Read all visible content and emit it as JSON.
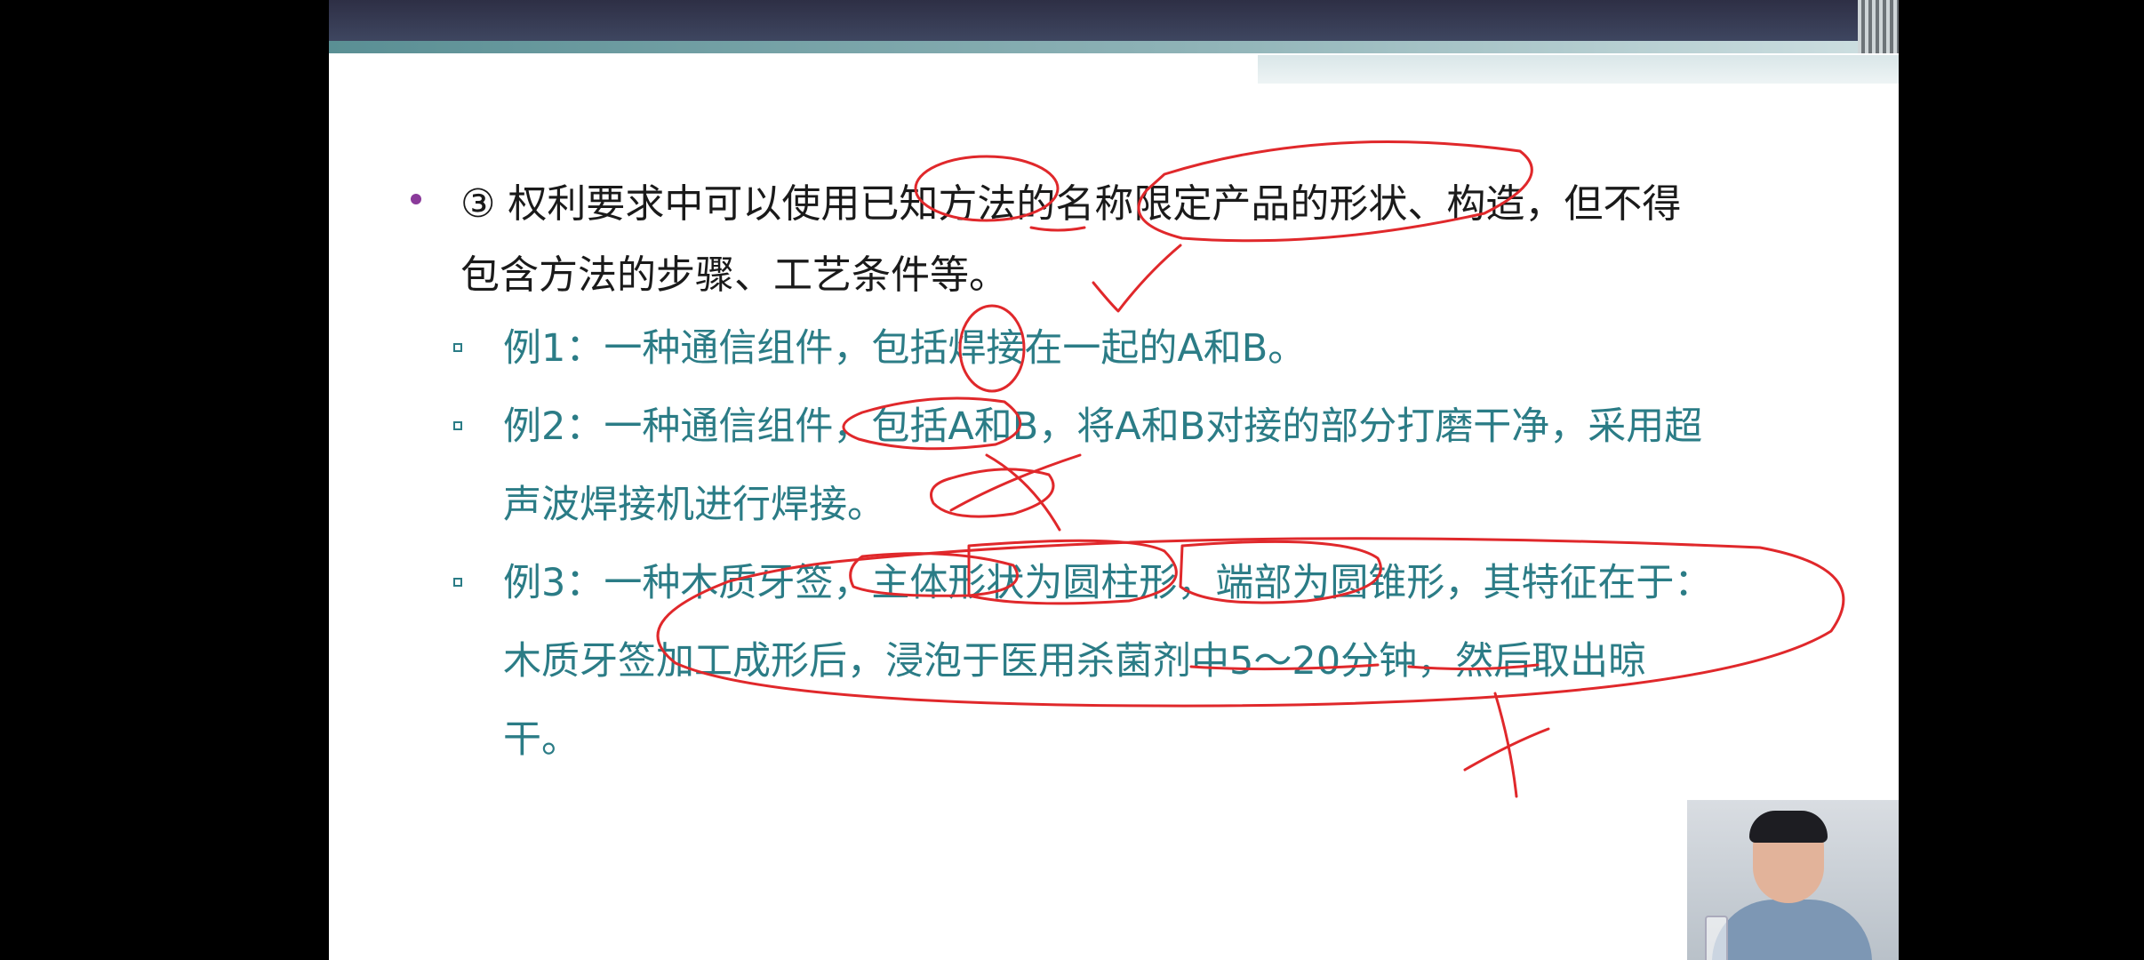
{
  "slide": {
    "main_bullet": "③ 权利要求中可以使用已知方法的名称限定产品的形状、构造，但不得包含方法的步骤、工艺条件等。",
    "examples": [
      {
        "text": "例1：一种通信组件，包括焊接在一起的A和B。"
      },
      {
        "text": "例2：一种通信组件，包括A和B，将A和B对接的部分打磨干净，采用超声波焊接机进行焊接。"
      },
      {
        "text": "例3：一种木质牙签，主体形状为圆柱形，端部为圆锥形，其特征在于：木质牙签加工成形后，浸泡于医用杀菌剂中5～20分钟，然后取出晾干。"
      }
    ]
  },
  "colors": {
    "main_text": "#1a1a1a",
    "sub_text": "#2b7c86",
    "annotation": "#e0282b",
    "bullet": "#8a3a9a"
  },
  "icons": {
    "main_bullet": "dot-bullet",
    "sub_bullet": "hollow-square-bullet"
  }
}
